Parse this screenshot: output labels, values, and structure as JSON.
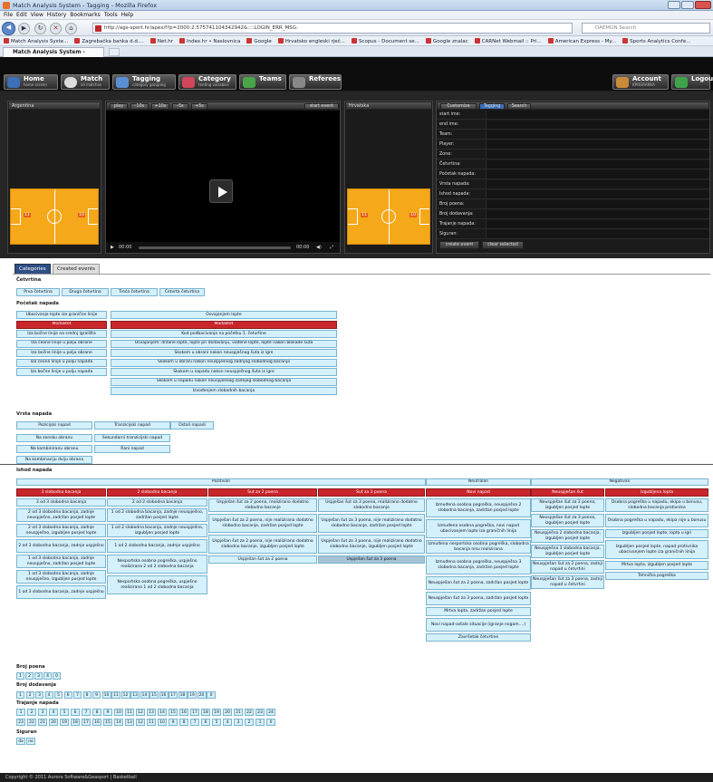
{
  "browser": {
    "title": "Match Analysis System - Tagging - Mozilla Firefox",
    "menu": [
      "File",
      "Edit",
      "View",
      "History",
      "Bookmarks",
      "Tools",
      "Help"
    ],
    "url": "http://ags-sport.hr/apex/f?p=2000:2:575741104342942&::::LOGIN_ERR_MSG:",
    "search_placeholder": "DAEMON Search",
    "bookmarks": [
      "Match Analysis Syste...",
      "Zagrebačka banka d.d....",
      "Net.hr",
      "Index.hr • Naslovnica",
      "Google",
      "Hrvatsko engleski rječ...",
      "Scopus - Document se...",
      "Google znalac",
      "CARNet Webmail :: Pri...",
      "American Express - My...",
      "Sports Analytics Confe..."
    ],
    "tab_label": "Match Analysis System - Tagging"
  },
  "appbar": {
    "buttons": [
      {
        "label": "Home",
        "sub": "home screen"
      },
      {
        "label": "Match",
        "sub": "all matches"
      },
      {
        "label": "Tagging",
        "sub": "category grouping"
      },
      {
        "label": "Category",
        "sub": "tenting variables"
      },
      {
        "label": "Teams",
        "sub": ""
      },
      {
        "label": "Referees",
        "sub": ""
      }
    ],
    "account_label": "Account",
    "account_sub": "KPOGRARKA",
    "logout_label": "Logout"
  },
  "video": {
    "team_left": "Argentina",
    "team_right": "Hrvatska",
    "controls": [
      "play",
      "-10s",
      "+10s",
      "-5s",
      "+5s"
    ],
    "start_event": "start event",
    "time_left": "00:00",
    "time_right": "00:00"
  },
  "tag_panel": {
    "tabs": [
      "Customize",
      "Tagging",
      "Search"
    ],
    "fields": [
      "start ime:",
      "end ime:",
      "Team:",
      "Player:",
      "Zone:",
      "Četvrtina:",
      "Početak napada:",
      "Vrsta napada:",
      "Ishod napada:",
      "Broj poena:",
      "Broj dodavanja:",
      "Trajanje napada:",
      "Siguran:"
    ],
    "create_event": "create event",
    "clear_selected": "clear selected"
  },
  "lower": {
    "tabs": [
      "Categories",
      "Created events"
    ],
    "cetvrtina_title": "Četvrtina",
    "cetvrtina": [
      "Prva četvrtina",
      "Druga četvrtina",
      "Treća četvrtina",
      "Četvrta četvrtina"
    ],
    "pocetak_title": "Početak napada",
    "pocetak_left": [
      "Ubacivanje lopte iza granične linije",
      "Modalitet",
      "Iza bočne linije na srednj igrališta",
      "Iza čeone linije u polju obrane",
      "Iza bočne linije u polju obrane",
      "Iza čeone linije u polju napada",
      "Iza bočne linije u polju napada"
    ],
    "pocetak_right": [
      "Osvajanjem lopte",
      "Modalitet",
      "Kod podbacivanja na početku 1. četvrtine",
      "Osvajanjem: držane lopte, lopte pri dodavanju, vođene lopte, lopte nakon blokade šuta",
      "Skokom u obrani nakon neuspješnog šuta iz igre",
      "Skokom u obrani nakon neuspješnog zadnjeg slobodnog bacanja",
      "Skokom u napadu nakon neuspješnog šuta iz igre",
      "Skokom u napadu nakon neuspješnog zadnjeg slobodnog bacanja",
      "Izvođenjem slobodnih bacanja"
    ],
    "vrsta_title": "Vrsta napada",
    "vrsta": [
      "Pozicijski napad",
      "Tranzicijski napad",
      "Ostali napadi",
      "Na zonsku obranu",
      "Sekundarni tranzicijski napad",
      "Na kombiniranu obranu",
      "Rani napad",
      "Na kombinaciju dviju obrana"
    ],
    "ishod_title": "Ishod napada",
    "ishod_groups": [
      "Pozitivan",
      "Neutralan",
      "Negativan"
    ],
    "ishod_cols": [
      {
        "head": "3 slobodna bacanja",
        "items": [
          "3 od 3 slobodna bacanja",
          "2 od 3 slobodna bacanja, zadnje neuspješno, zadržan posjed lopte",
          "2 od 3 slobodna bacanja, zadnje neuspješno, izgubljen posjed lopte",
          "2 od 3 slobodna bacanja, zadnje uspješno",
          "1 od 3 slobodna bacanja, zadnje neuspješno, zadržan posjed lopte",
          "1 od 3 slobodna bacanja, zadnje neuspješno, izgubljen posjed lopte",
          "1 od 3 slobodna bacanja, zadnje uspješno"
        ]
      },
      {
        "head": "2 slobodna bacanja",
        "items": [
          "2 od 2 slobodna bacanja",
          "1 od 2 slobodna bacanja, zadnje neuspješno, zadržan posjed lopte",
          "1 od 2 slobodna bacanja, zadnje neuspješno, izgubljen posjed lopte",
          "1 od 2 slobodna bacanja, zadnje uspješno",
          "Nesportska osobna pogreška, uspješno realizirana 2 od 2 slobodna bacanja",
          "Nesportska osobna pogreška, uspješno realizirano 1 od 2 slobodna bacanja"
        ]
      },
      {
        "head": "Šut za 2 poena",
        "items": [
          "Uspješan šut za 2 poena, realizirano dodatno slobodno bacanje",
          "Uspješan šut za 2 poena, nije realizirano dodatno slobodno bacanje, zadržan posjed lopte",
          "Uspješan šut za 2 poena, nije realizirano dodatno slobodno bacanje, izgubljen posjed lopte",
          "Uspješan šut za 2 poena"
        ]
      },
      {
        "head": "Šut za 3 poena",
        "items": [
          "Uspješan šut za 3 poena, realizirano dodatno slobodno bacanje",
          "Uspješan šut za 3 poena, nije realizirano dodatno slobodno bacanje, zadržan posjed lopte",
          "Uspješan šut za 3 poena, nije realizirano dodatno slobodno bacanje, izgubljen posjed lopte",
          "Uspješan šut za 3 poena"
        ]
      },
      {
        "head": "Novi napad",
        "items": [
          "Izmuđena osobna pogreška, neuspješna 2 slobodna bacanja, zadržan posjed lopte",
          "Izmuđena osobna pogreška, novi napad ubacivanjem lopte iza graničnih linija",
          "Izmuđena nesportska osobna pogreška, slobodna bacanja nisu realizirana",
          "Izmuđena osobna pogreška, neuspješna 3 slobodna bacanja, zadržan posjed lopte",
          "Neuspješan šut za 2 poena, zadržan posjed lopte",
          "Neuspješan šut za 3 poena, zadržan posjed lopte",
          "Mrtva lopta, zadržan posjed lopte",
          "Novi napad-ostale situacije (igranje nogom....)",
          "Završetak četvrtine"
        ]
      },
      {
        "head": "Neuspješan šut",
        "items": [
          "Neuspješan šut za 2 poena, izgubljen posjed lopte",
          "Neuspješan šut za 3 poena, izgubljen posjed lopte",
          "Neuspješna 2 slobodna bacanja, izgubljen posjed lopte",
          "Neuspješna 3 slobodna bacanja, izgubljen posjed lopte",
          "Neuspješan šut za 2 poena, zadnji napad u četvrtini",
          "Neuspješan šut za 3 poena, zadnji napad u četvrtini"
        ]
      },
      {
        "head": "Izgubljena lopta",
        "items": [
          "Osobna pogreška u napadu, ekipa u bonusu, slobodna bacanja protivnika",
          "Osobna pogreška u napadu, ekipa nije u bonusu",
          "Izgubljen posjed lopte, lopta u igri",
          "Izgubljen posjed lopte, napad protivnika ubacivanjem lopte iza graničnih linija",
          "Mrtva lopta, izgubljen posjed lopte",
          "Tehnička pogreška"
        ]
      }
    ],
    "broj_poena_title": "Broj poena",
    "broj_poena": [
      "1",
      "2",
      "3",
      "4",
      "0"
    ],
    "broj_dodavanja_title": "Broj dodavanja",
    "broj_dodavanja": [
      "1",
      "2",
      "3",
      "4",
      "5",
      "6",
      "7",
      "8",
      "9",
      "10",
      "11",
      "12",
      "13",
      "14",
      "15",
      "16",
      "17",
      "18",
      "19",
      "20",
      "0"
    ],
    "trajanje_title": "Trajanje napada",
    "trajanje_row1": [
      "1",
      "2",
      "3",
      "4",
      "5",
      "6",
      "7",
      "8",
      "9",
      "10",
      "11",
      "12",
      "13",
      "14",
      "15",
      "16",
      "17",
      "18",
      "19",
      "20",
      "21",
      "22",
      "23",
      "24"
    ],
    "trajanje_row2": [
      "23",
      "22",
      "21",
      "20",
      "19",
      "18",
      "17",
      "16",
      "15",
      "14",
      "13",
      "12",
      "11",
      "10",
      "9",
      "8",
      "7",
      "6",
      "5",
      "4",
      "3",
      "2",
      "1",
      "0"
    ],
    "siguran_title": "Siguran",
    "siguran": [
      "da",
      "ne"
    ]
  },
  "footer": "Copyright © 2011 Aurora Software&Geasport | Basketball"
}
